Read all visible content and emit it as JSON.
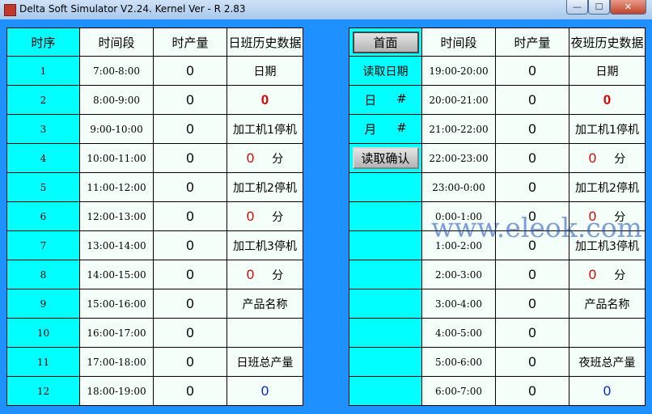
{
  "window": {
    "title": "Delta Soft Simulator V2.24. Kernel Ver - R 2.83",
    "min_glyph": "—",
    "max_glyph": "☐",
    "close_glyph": "✕"
  },
  "day_table": {
    "headers": [
      "时序",
      "时间段",
      "时产量",
      "日班历史数据"
    ],
    "rows": [
      {
        "index": "1",
        "time": "7:00-8:00",
        "output": "0"
      },
      {
        "index": "2",
        "time": "8:00-9:00",
        "output": "0"
      },
      {
        "index": "3",
        "time": "9:00-10:00",
        "output": "0"
      },
      {
        "index": "4",
        "time": "10:00-11:00",
        "output": "0"
      },
      {
        "index": "5",
        "time": "11:00-12:00",
        "output": "0"
      },
      {
        "index": "6",
        "time": "12:00-13:00",
        "output": "0"
      },
      {
        "index": "7",
        "time": "13:00-14:00",
        "output": "0"
      },
      {
        "index": "8",
        "time": "14:00-15:00",
        "output": "0"
      },
      {
        "index": "9",
        "time": "15:00-16:00",
        "output": "0"
      },
      {
        "index": "10",
        "time": "16:00-17:00",
        "output": "0"
      },
      {
        "index": "11",
        "time": "17:00-18:00",
        "output": "0"
      },
      {
        "index": "12",
        "time": "18:00-19:00",
        "output": "0"
      }
    ],
    "history": {
      "date_label": "日期",
      "date_value": "0",
      "machine1_label": "加工机1停机",
      "machine1_value": "0",
      "machine2_label": "加工机2停机",
      "machine2_value": "0",
      "machine3_label": "加工机3停机",
      "machine3_value": "0",
      "minute_unit": "分",
      "product_label": "产品名称",
      "product_value": "",
      "total_label": "日班总产量",
      "total_value": "0"
    }
  },
  "controls": {
    "home_button": "首面",
    "read_date_label": "读取日期",
    "day_label": "日",
    "month_label": "月",
    "hash": "#",
    "confirm_button": "读取确认"
  },
  "night_table": {
    "headers": [
      "时间段",
      "时产量",
      "夜班历史数据"
    ],
    "rows": [
      {
        "time": "19:00-20:00",
        "output": "0"
      },
      {
        "time": "20:00-21:00",
        "output": "0"
      },
      {
        "time": "21:00-22:00",
        "output": "0"
      },
      {
        "time": "22:00-23:00",
        "output": "0"
      },
      {
        "time": "23:00-0:00",
        "output": "0"
      },
      {
        "time": "0:00-1:00",
        "output": "0"
      },
      {
        "time": "1:00-2:00",
        "output": "0"
      },
      {
        "time": "2:00-3:00",
        "output": "0"
      },
      {
        "time": "3:00-4:00",
        "output": "0"
      },
      {
        "time": "4:00-5:00",
        "output": "0"
      },
      {
        "time": "5:00-6:00",
        "output": "0"
      },
      {
        "time": "6:00-7:00",
        "output": "0"
      }
    ],
    "history": {
      "date_label": "日期",
      "date_value": "0",
      "machine1_label": "加工机1停机",
      "machine1_value": "0",
      "machine2_label": "加工机2停机",
      "machine2_value": "0",
      "machine3_label": "加工机3停机",
      "machine3_value": "0",
      "minute_unit": "分",
      "product_label": "产品名称",
      "product_value": "",
      "total_label": "夜班总产量",
      "total_value": "0"
    }
  },
  "watermark": "www.eleok.com",
  "colors": {
    "background": "#1e90ff",
    "index_cell": "#00ffff",
    "value_cell": "#f5fffa",
    "alarm_value": "#e00000",
    "total_value": "#0020e0"
  }
}
